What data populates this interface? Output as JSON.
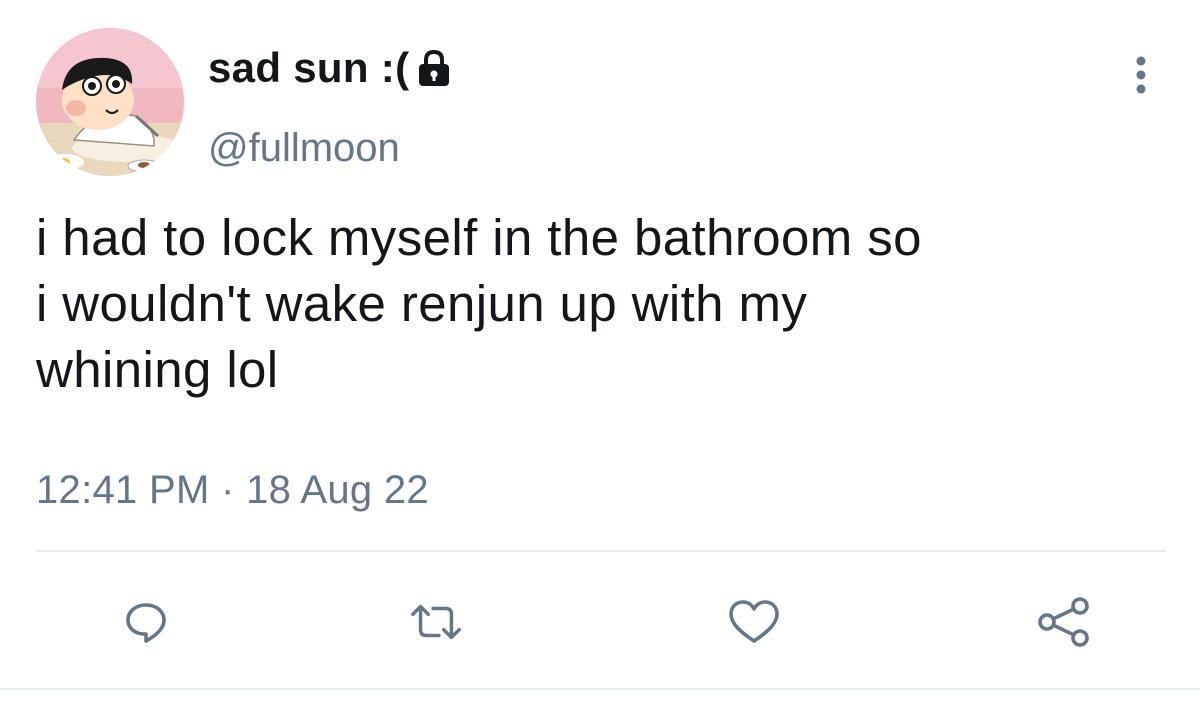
{
  "user": {
    "display_name": "sad sun :(",
    "handle": "@fullmoon",
    "protected": true,
    "avatar": "cartoon-boy-eating-avatar"
  },
  "tweet": {
    "text": "i had to lock myself in the bathroom so\ni wouldn't wake renjun up with my\nwhining lol",
    "time": "12:41 PM",
    "separator": "·",
    "date": "18 Aug 22"
  },
  "actions": {
    "icons": [
      "reply-icon",
      "retweet-icon",
      "like-icon",
      "share-icon"
    ]
  },
  "colors": {
    "text": "#14171a",
    "secondary": "#657786",
    "divider": "#e6ecf0"
  }
}
